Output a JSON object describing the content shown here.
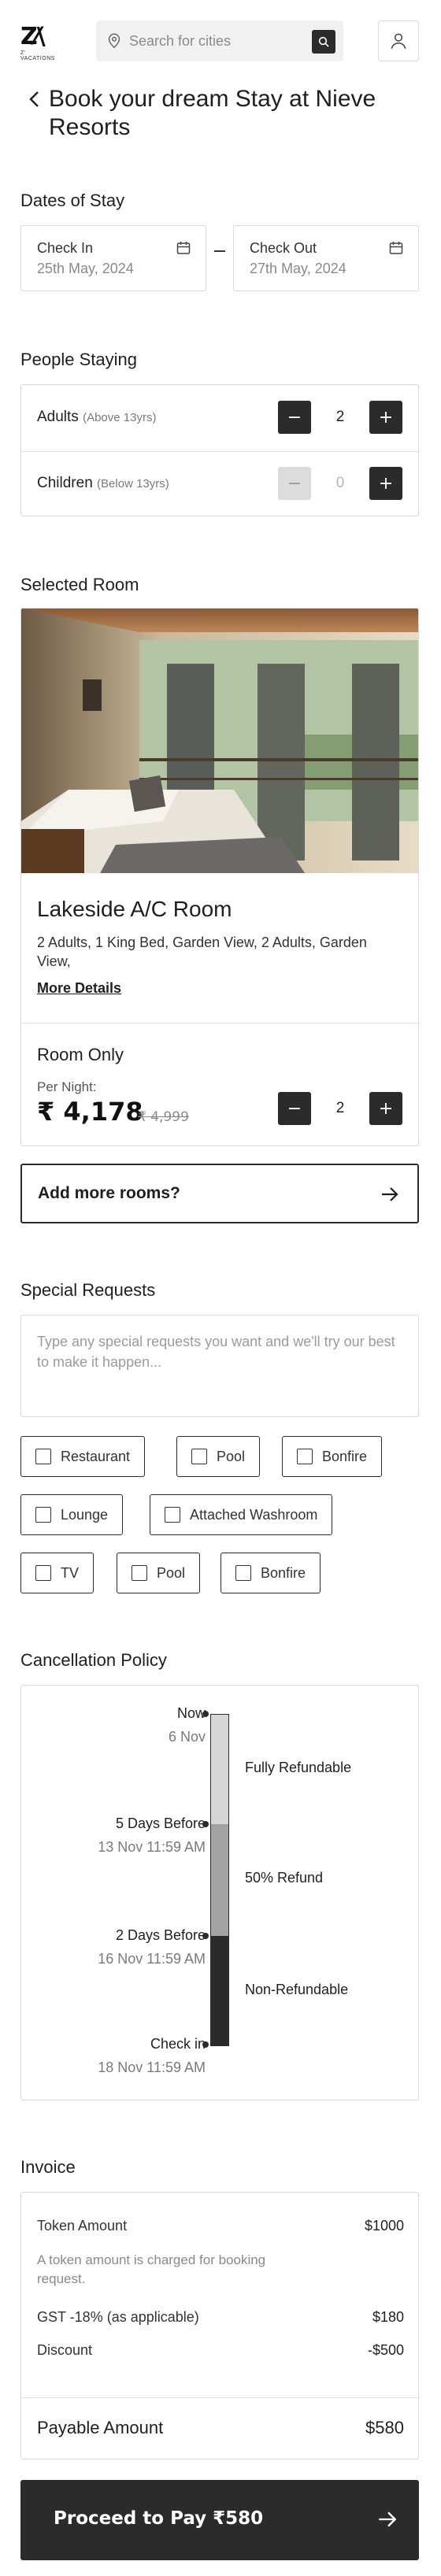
{
  "header": {
    "logo_text": "Z' VACATIONS",
    "search_placeholder": "Search for cities"
  },
  "page_title": "Book your dream Stay at Nieve Resorts",
  "dates": {
    "section_title": "Dates of Stay",
    "check_in_label": "Check In",
    "check_in_value": "25th May, 2024",
    "check_out_label": "Check Out",
    "check_out_value": "27th May, 2024"
  },
  "people": {
    "section_title": "People Staying",
    "adults_label": "Adults",
    "adults_note": "(Above 13yrs)",
    "adults_value": "2",
    "children_label": "Children",
    "children_note": "(Below 13yrs)",
    "children_value": "0"
  },
  "room": {
    "section_title": "Selected Room",
    "name": "Lakeside A/C Room",
    "description": "2 Adults, 1 King Bed, Garden View, 2 Adults, Garden View,",
    "more_details": "More Details",
    "plan": "Room Only",
    "per_night_label": "Per Night:",
    "price": "₹ 4,178",
    "old_price": "₹ 4,999",
    "quantity": "2"
  },
  "add_more_rooms": "Add more rooms?",
  "special_requests": {
    "section_title": "Special Requests",
    "placeholder": "Type any special requests you want and we'll try our best to make it happen...",
    "options": [
      "Restaurant",
      "Pool",
      "Bonfire",
      "Lounge",
      "Attached Washroom",
      "TV",
      "Pool",
      "Bonfire"
    ]
  },
  "cancellation": {
    "section_title": "Cancellation Policy",
    "points": [
      {
        "label": "Now",
        "date": "6 Nov"
      },
      {
        "label": "5 Days Before",
        "date": "13 Nov 11:59 AM"
      },
      {
        "label": "2 Days Before",
        "date": "16 Nov 11:59 AM"
      },
      {
        "label": "Check in",
        "date": "18 Nov 11:59 AM"
      }
    ],
    "statuses": [
      "Fully Refundable",
      "50% Refund",
      "Non-Refundable"
    ],
    "colors": {
      "fully": "#d6d6d6",
      "half": "#a3a3a3",
      "none": "#2b2b2b"
    }
  },
  "invoice": {
    "section_title": "Invoice",
    "token_label": "Token Amount",
    "token_value": "$1000",
    "token_note": "A token amount is charged for booking request.",
    "gst_label": "GST -18% (as applicable)",
    "gst_value": "$180",
    "discount_label": "Discount",
    "discount_value": "-$500",
    "payable_label": "Payable Amount",
    "payable_value": "$580"
  },
  "pay_button": "Proceed to Pay ₹580",
  "colors": {
    "primary": "#2b2b2b",
    "border": "#d9d9d9",
    "muted": "#8a8a8a"
  }
}
